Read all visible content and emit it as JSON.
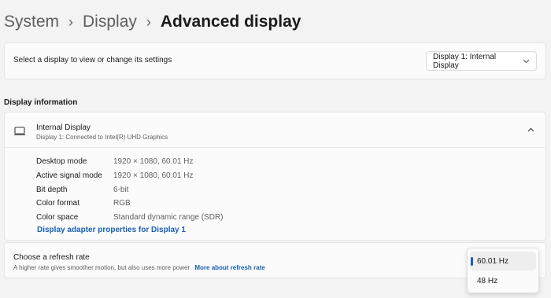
{
  "breadcrumb": {
    "items": [
      "System",
      "Display",
      "Advanced display"
    ],
    "separator": "›"
  },
  "select_display": {
    "label": "Select a display to view or change its settings",
    "dropdown_value": "Display 1: Internal Display"
  },
  "display_information": {
    "section_title": "Display information",
    "device": {
      "name": "Internal Display",
      "subtitle": "Display 1: Connected to Intel(R) UHD Graphics",
      "icon": "monitor-icon",
      "expanded": true
    },
    "rows": [
      {
        "key": "Desktop mode",
        "value": "1920 × 1080, 60.01 Hz"
      },
      {
        "key": "Active signal mode",
        "value": "1920 × 1080, 60.01 Hz"
      },
      {
        "key": "Bit depth",
        "value": "6-bit"
      },
      {
        "key": "Color format",
        "value": "RGB"
      },
      {
        "key": "Color space",
        "value": "Standard dynamic range (SDR)"
      }
    ],
    "adapter_link": "Display adapter properties for Display 1"
  },
  "refresh_rate": {
    "title": "Choose a refresh rate",
    "subtitle": "A higher rate gives smoother motion, but also uses more power",
    "link": "More about refresh rate",
    "options": [
      "60.01 Hz",
      "48 Hz"
    ],
    "selected": "60.01 Hz"
  },
  "colors": {
    "background": "#f3f3f3",
    "card": "#fbfbfb",
    "accent": "#1a5fb4"
  }
}
